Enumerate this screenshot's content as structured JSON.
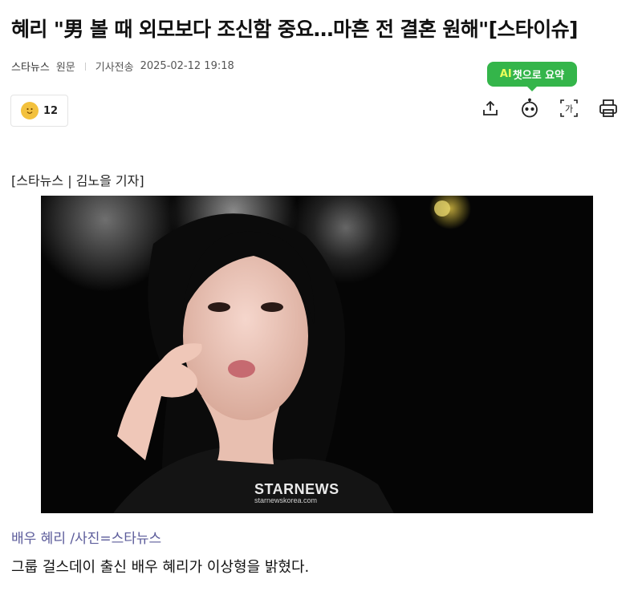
{
  "article": {
    "headline": "혜리 \"男 볼 때 외모보다 조신함 중요…마흔 전 결혼 원해\"[스타이슈]",
    "press": "스타뉴스",
    "source_label": "원문",
    "sent_label": "기사전송",
    "timestamp": "2025-02-12 19:18",
    "byline": "[스타뉴스 | 김노을 기자]",
    "caption": "배우 혜리 /사진=스타뉴스",
    "body": "그룹 걸스데이 출신 배우 혜리가 이상형을 밝혔다."
  },
  "reaction": {
    "count": "12",
    "icon": "reaction-face-icon"
  },
  "ai_summary": {
    "prefix": "AI",
    "label": "챗으로 요약"
  },
  "toolbar": {
    "icons": [
      "share-icon",
      "ai-bot-icon",
      "font-size-icon",
      "print-icon"
    ],
    "font_glyph": "가"
  },
  "photo": {
    "watermark_title": "STARNEWS",
    "watermark_url": "starnewskorea.com"
  },
  "colors": {
    "ai_bubble": "#34b54a",
    "caption": "#5b5b9a",
    "reaction": "#f3c13d"
  }
}
